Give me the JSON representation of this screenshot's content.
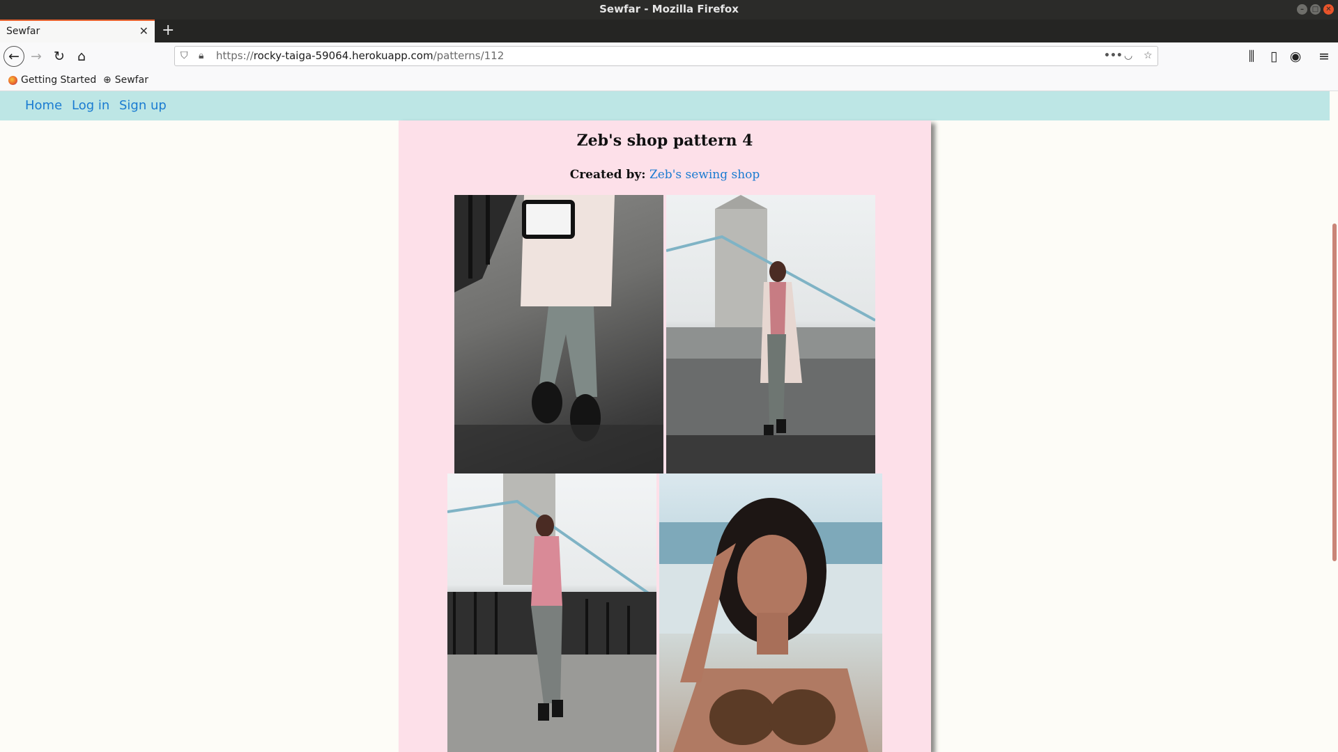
{
  "window": {
    "title": "Sewfar - Mozilla Firefox"
  },
  "tab": {
    "label": "Sewfar",
    "close": "✕",
    "new_tab": "+"
  },
  "urlbar": {
    "scheme": "https://",
    "host": "rocky-taiga-59064.herokuapp.com",
    "path": "/patterns/112"
  },
  "bookmarks": [
    {
      "label": "Getting Started",
      "icon": "firefox-icon"
    },
    {
      "label": "Sewfar",
      "icon": "globe-icon"
    }
  ],
  "site_nav": {
    "home": "Home",
    "login": "Log in",
    "signup": "Sign up"
  },
  "pattern": {
    "title": "Zeb's shop pattern 4",
    "created_by_label": "Created by:",
    "creator": "Zeb's sewing shop"
  },
  "colors": {
    "nav_bg": "#bde6e5",
    "card_bg": "#fde0e9",
    "link": "#1a7bd1",
    "page_bg": "#fdfcf7"
  }
}
